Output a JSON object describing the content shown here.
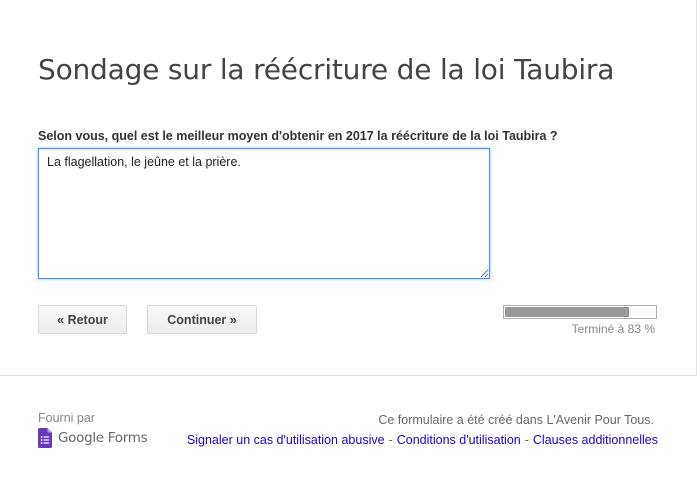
{
  "form": {
    "title": "Sondage sur la réécriture de la loi Taubira",
    "question": {
      "label": "Selon vous, quel est le meilleur moyen d'obtenir en 2017 la réécriture de la loi Taubira ?",
      "answer": "La flagellation, le jeûne et la prière."
    },
    "buttons": {
      "back_label": "« Retour",
      "continue_label": "Continuer »"
    },
    "progress": {
      "percent": 83,
      "label": "Terminé à 83 %"
    }
  },
  "footer": {
    "provided_by": "Fourni par",
    "logo_text": "Google Forms",
    "created_in": "Ce formulaire a été créé dans L'Avenir Pour Tous.",
    "links": {
      "abuse": "Signaler un cas d'utilisation abusive",
      "terms": "Conditions d'utilisation",
      "additional": "Clauses additionnelles",
      "separator": "-"
    }
  },
  "colors": {
    "link": "#2200cc",
    "progress_fill": "#999999",
    "focus_border": "#4d90fe",
    "forms_icon": "#673ab7"
  },
  "icons": {
    "logo": "google-forms-icon"
  }
}
